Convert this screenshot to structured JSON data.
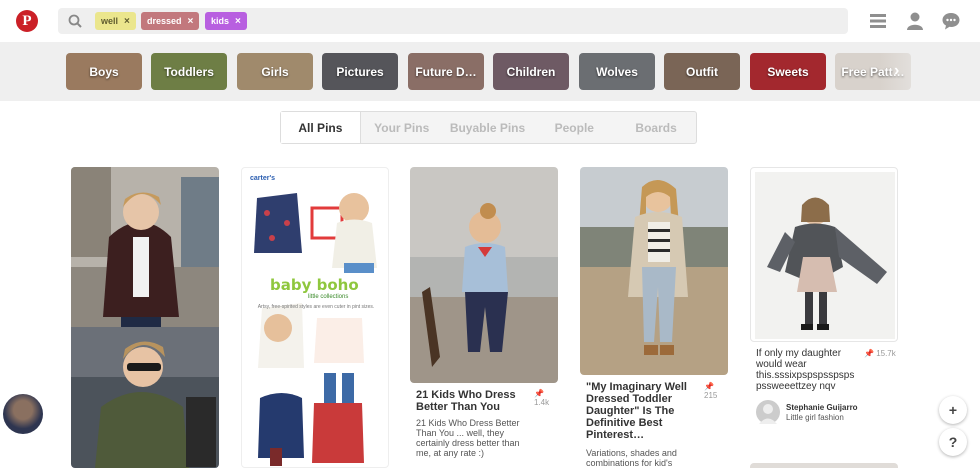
{
  "header": {
    "logo_letter": "P",
    "search_tokens": [
      {
        "label": "well",
        "remove": "×"
      },
      {
        "label": "dressed",
        "remove": "×"
      },
      {
        "label": "kids",
        "remove": "×"
      }
    ],
    "icons": [
      "search-icon",
      "menu-icon",
      "user-icon",
      "chat-icon"
    ]
  },
  "guides": [
    {
      "label": "Boys",
      "color": "#9a7a5f"
    },
    {
      "label": "Toddlers",
      "color": "#6e7e45"
    },
    {
      "label": "Girls",
      "color": "#a08a6c"
    },
    {
      "label": "Pictures",
      "color": "#55555a"
    },
    {
      "label": "Future D…",
      "color": "#8a6e66"
    },
    {
      "label": "Children",
      "color": "#6e5a64"
    },
    {
      "label": "Wolves",
      "color": "#6b6e72"
    },
    {
      "label": "Outfit",
      "color": "#7a6556"
    },
    {
      "label": "Sweets",
      "color": "#a3282e"
    },
    {
      "label": "Free Patt…",
      "color": "#d8d2cc"
    }
  ],
  "filters": {
    "items": [
      "All Pins",
      "Your Pins",
      "Buyable Pins",
      "People",
      "Boards"
    ],
    "active": "All Pins"
  },
  "pins": [
    {
      "title": "",
      "desc": "",
      "count": ""
    },
    {
      "title": "",
      "desc": "",
      "count": "",
      "brand": "carter's",
      "headline": "baby boho",
      "sub": "little collections",
      "tagline": "Artsy, free-spirited styles are even cuter in pint sizes."
    },
    {
      "title": "21 Kids Who Dress Better Than You",
      "desc": "21 Kids Who Dress Better Than You ... well, they certainly dress better than me, at any rate :)",
      "count": "1.4k"
    },
    {
      "title": "\"My Imaginary Well Dressed Toddler Daughter\" Is The Definitive Best Pinterest…",
      "desc": "Variations, shades and combinations for kid's",
      "count": "215"
    },
    {
      "title": "",
      "desc": "If only my daughter would wear this.sssixpspspsspsps pssweeettzey nqv",
      "count": "15.7k",
      "pinner": "Stephanie Guijarro",
      "board": "Little girl fashion"
    }
  ],
  "floating": {
    "add": "+",
    "help": "?"
  }
}
